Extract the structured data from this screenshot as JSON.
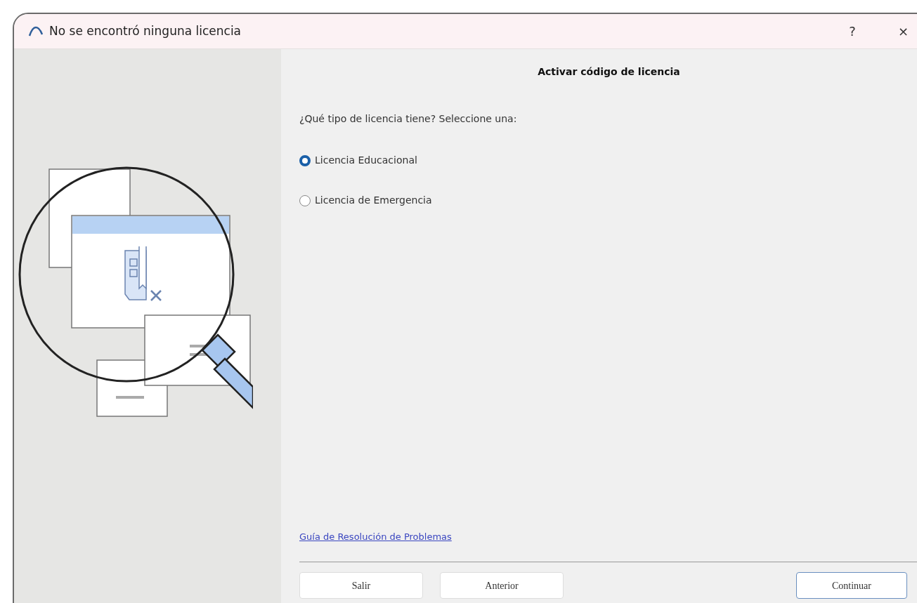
{
  "window": {
    "title": "No se encontró ninguna licencia",
    "help": "?",
    "close": "×"
  },
  "heading": "Activar código de licencia",
  "question": "¿Qué tipo de licencia tiene? Seleccione una:",
  "options": [
    {
      "label": "Licencia Educacional",
      "selected": true
    },
    {
      "label": "Licencia de Emergencia",
      "selected": false
    }
  ],
  "link": "Guía de Resolución de Problemas",
  "buttons": [
    {
      "label": "Salir",
      "default": false
    },
    {
      "label": "Anterior",
      "default": false
    },
    {
      "label": "Continuar",
      "default": true
    }
  ]
}
